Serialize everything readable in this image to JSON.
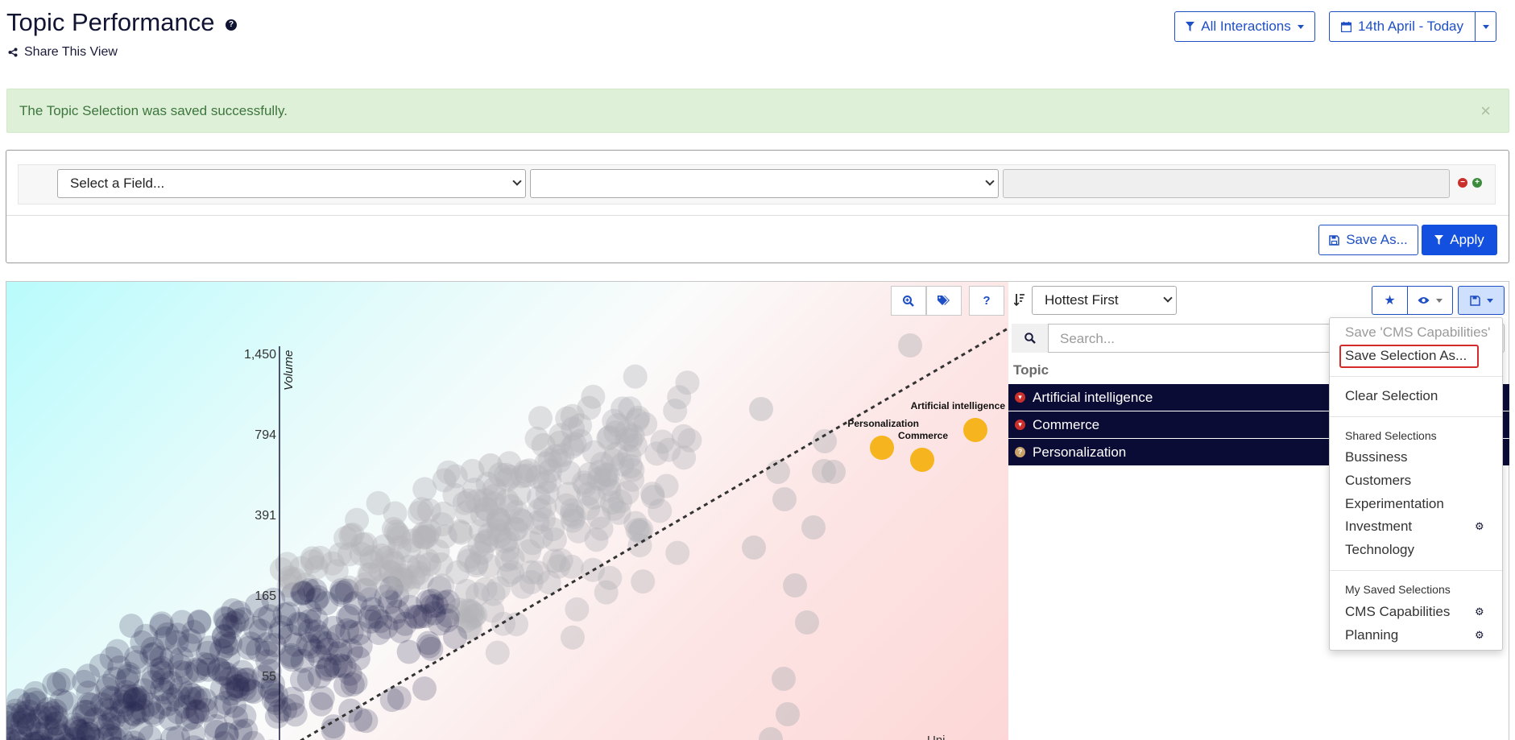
{
  "header": {
    "title": "Topic Performance",
    "share_label": "Share This View",
    "filter_btn": "All Interactions",
    "date_btn": "14th April - Today"
  },
  "alert": {
    "message": "The Topic Selection was saved successfully.",
    "close": "×"
  },
  "filters": {
    "field_select": "Select a Field...",
    "operator_select": "",
    "value_input": "",
    "save_as_label": "Save As...",
    "apply_label": "Apply"
  },
  "chart_tools": {
    "help_label": "?"
  },
  "chart_data": {
    "type": "scatter",
    "ylabel": "Volume",
    "xlabel": "Uni",
    "yticks": [
      "1,450",
      "794",
      "391",
      "165",
      "55"
    ],
    "highlighted_points": [
      {
        "label": "Artificial intelligence"
      },
      {
        "label": "Personalization"
      },
      {
        "label": "Commerce"
      }
    ],
    "colors": {
      "highlight": "#f6b51f",
      "point": "#2a2a52",
      "grey": "#b4b4b8"
    }
  },
  "topics": {
    "sort_select": "Hottest First",
    "search_placeholder": "Search...",
    "column_header": "Topic",
    "rows": [
      {
        "label": "Artificial intelligence",
        "icon": "fire-icon"
      },
      {
        "label": "Commerce",
        "icon": "fire-icon"
      },
      {
        "label": "Personalization",
        "icon": "question-icon"
      }
    ]
  },
  "dropdown": {
    "save_current": "Save 'CMS Capabilities'",
    "save_as": "Save Selection As...",
    "clear": "Clear Selection",
    "shared_header": "Shared Selections",
    "shared": [
      "Bussiness",
      "Customers",
      "Experimentation",
      "Investment",
      "Technology"
    ],
    "mine_header": "My Saved Selections",
    "mine": [
      "CMS Capabilities",
      "Planning"
    ]
  }
}
